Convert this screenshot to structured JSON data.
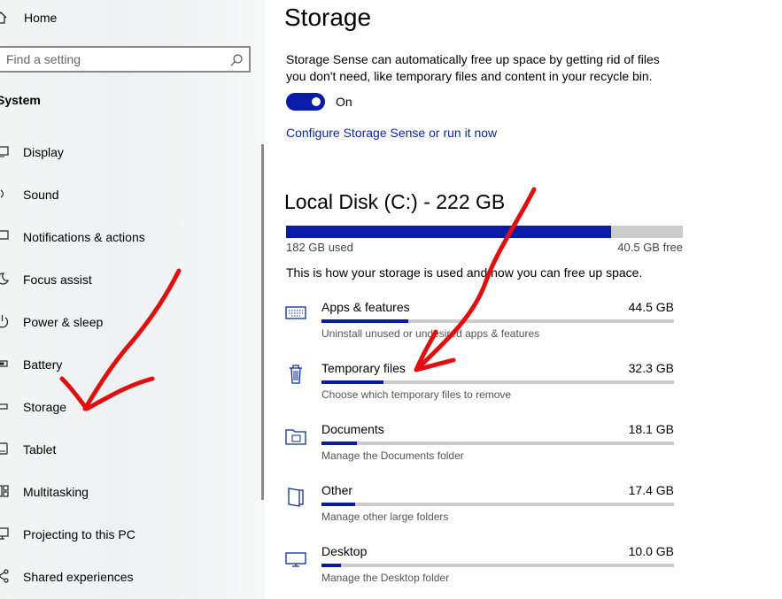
{
  "sidebar": {
    "home_label": "Home",
    "search_placeholder": "Find a setting",
    "section_title": "System",
    "items": [
      {
        "label": "Display",
        "icon": "display-icon"
      },
      {
        "label": "Sound",
        "icon": "sound-icon"
      },
      {
        "label": "Notifications & actions",
        "icon": "notifications-icon"
      },
      {
        "label": "Focus assist",
        "icon": "focus-assist-icon"
      },
      {
        "label": "Power & sleep",
        "icon": "power-icon"
      },
      {
        "label": "Battery",
        "icon": "battery-icon"
      },
      {
        "label": "Storage",
        "icon": "storage-icon"
      },
      {
        "label": "Tablet",
        "icon": "tablet-icon"
      },
      {
        "label": "Multitasking",
        "icon": "multitasking-icon"
      },
      {
        "label": "Projecting to this PC",
        "icon": "projecting-icon"
      },
      {
        "label": "Shared experiences",
        "icon": "shared-experiences-icon"
      }
    ]
  },
  "main": {
    "title": "Storage",
    "sense_description": "Storage Sense can automatically free up space by getting rid of files you don't need, like temporary files and content in your recycle bin.",
    "sense_toggle_state": "On",
    "sense_toggle_on": true,
    "configure_link": "Configure Storage Sense or run it now",
    "disk": {
      "title": "Local Disk (C:) - 222 GB",
      "used_label": "182 GB used",
      "free_label": "40.5 GB free",
      "used_fraction": 0.82
    },
    "usage_description": "This is how your storage is used and how you can free up space.",
    "categories": [
      {
        "name": "Apps & features",
        "size": "44.5 GB",
        "subtitle": "Uninstall unused or undesired apps & features",
        "fraction": 0.245,
        "icon": "keyboard-icon"
      },
      {
        "name": "Temporary files",
        "size": "32.3 GB",
        "subtitle": "Choose which temporary files to remove",
        "fraction": 0.175,
        "icon": "trash-icon"
      },
      {
        "name": "Documents",
        "size": "18.1 GB",
        "subtitle": "Manage the Documents folder",
        "fraction": 0.1,
        "icon": "folder-icon"
      },
      {
        "name": "Other",
        "size": "17.4 GB",
        "subtitle": "Manage other large folders",
        "fraction": 0.095,
        "icon": "other-icon"
      },
      {
        "name": "Desktop",
        "size": "10.0 GB",
        "subtitle": "Manage the Desktop folder",
        "fraction": 0.055,
        "icon": "desktop-icon"
      }
    ]
  },
  "colors": {
    "accent": "#0a1ba8",
    "annotation": "#e01010",
    "link": "#0a2a9e"
  }
}
